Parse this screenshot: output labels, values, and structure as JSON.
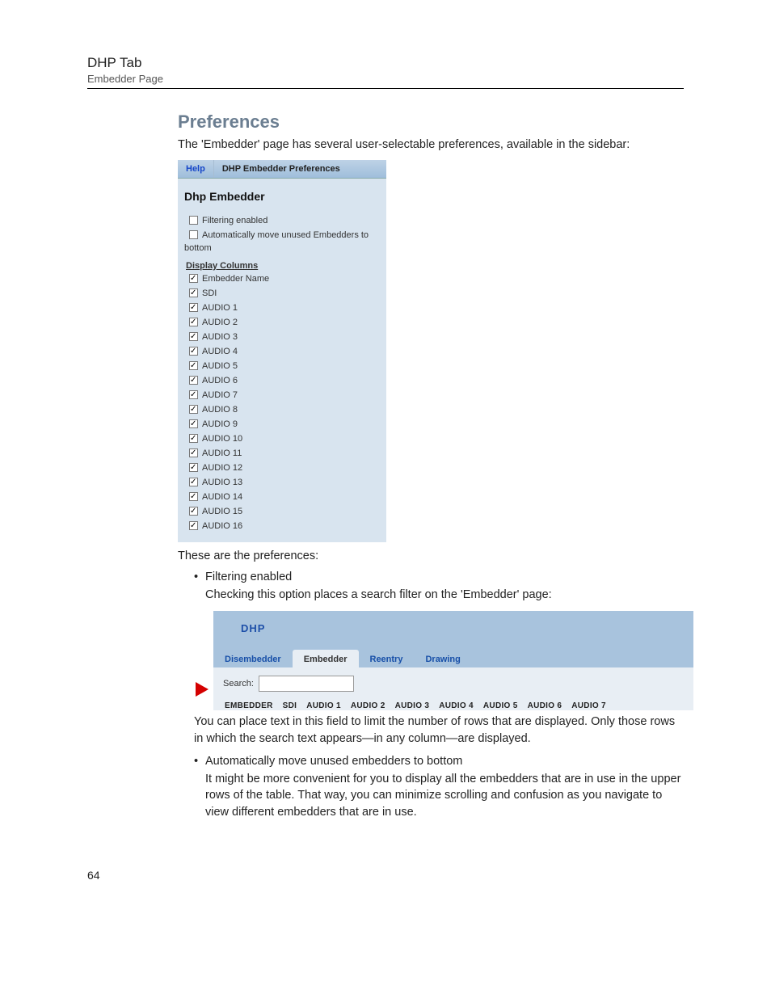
{
  "header": {
    "title": "DHP Tab",
    "subtitle": "Embedder Page"
  },
  "section_heading": "Preferences",
  "intro": "The 'Embedder' page has several user-selectable preferences, available in the sidebar:",
  "prefs_panel": {
    "help": "Help",
    "title": "DHP Embedder Preferences",
    "heading": "Dhp Embedder",
    "opt_filtering": "Filtering enabled",
    "opt_auto_move": "Automatically move unused Embedders to",
    "opt_auto_move2": "bottom",
    "display_columns_label": "Display Columns",
    "columns": [
      "Embedder Name",
      "SDI",
      "AUDIO 1",
      "AUDIO 2",
      "AUDIO 3",
      "AUDIO 4",
      "AUDIO 5",
      "AUDIO 6",
      "AUDIO 7",
      "AUDIO 8",
      "AUDIO 9",
      "AUDIO 10",
      "AUDIO 11",
      "AUDIO 12",
      "AUDIO 13",
      "AUDIO 14",
      "AUDIO 15",
      "AUDIO 16"
    ]
  },
  "after_panel": "These are the preferences:",
  "bullets": {
    "b1_title": "Filtering enabled",
    "b1_desc": "Checking this option places a search filter on the 'Embedder' page:",
    "b2_title": "Automatically move unused embedders to bottom",
    "b2_desc": "It might be more convenient for you to display all the embedders that are in use in the upper rows of the table. That way, you can minimize scrolling and confusion as you navigate to view different embedders that are in use."
  },
  "embedder_shot": {
    "dhp": "DHP",
    "tabs": [
      "Disembedder",
      "Embedder",
      "Reentry",
      "Drawing"
    ],
    "search_label": "Search:",
    "search_value": "",
    "columns": [
      "EMBEDDER",
      "SDI",
      "AUDIO 1",
      "AUDIO 2",
      "AUDIO 3",
      "AUDIO 4",
      "AUDIO 5",
      "AUDIO 6",
      "AUDIO 7"
    ]
  },
  "after_embedder": "You can place text in this field to limit the number of rows that are displayed. Only those rows in which the search text appears—in any column—are displayed.",
  "page_number": "64"
}
